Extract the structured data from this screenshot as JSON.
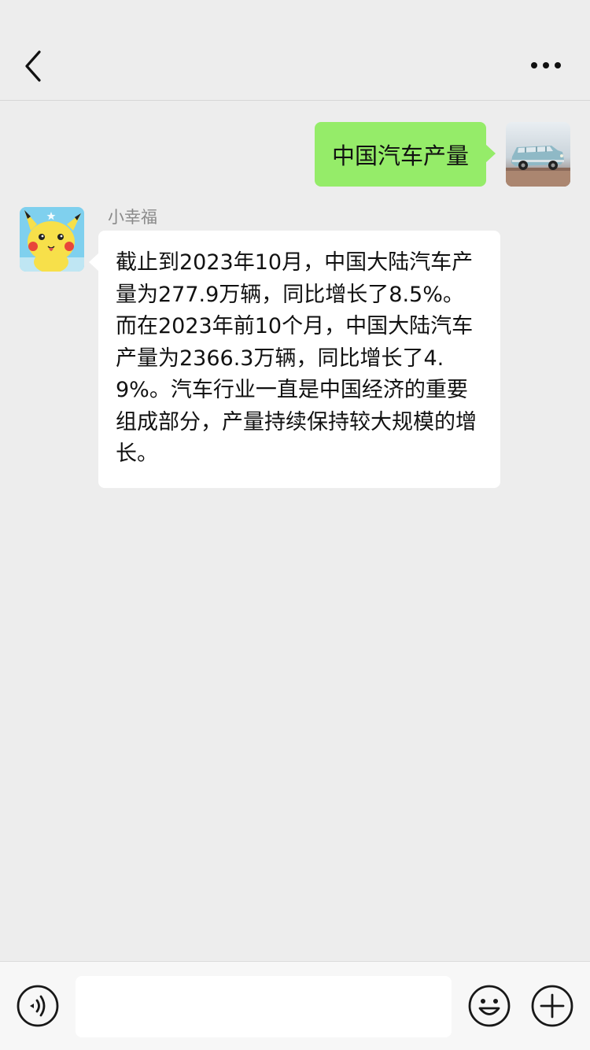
{
  "messages": {
    "outgoing": {
      "text": "中国汽车产量",
      "avatar_icon": "toy-car-avatar"
    },
    "incoming": {
      "sender": "小幸福",
      "avatar_icon": "pikachu-avatar",
      "text": "截止到2023年10月，中国大陆汽车产量为277.9万辆，同比增长了8.5%。而在2023年前10个月，中国大陆汽车产量为2366.3万辆，同比增长了4.9%。汽车行业一直是中国经济的重要组成部分，产量持续保持较大规模的增长。"
    }
  },
  "nav": {
    "back_icon": "chevron-left-icon",
    "more_icon": "more-dots-icon"
  },
  "input_bar": {
    "voice_icon": "voice-icon",
    "text_value": "",
    "emoji_icon": "emoji-icon",
    "plus_icon": "plus-icon"
  },
  "colors": {
    "background": "#ededed",
    "outgoing_bubble": "#95ec69",
    "incoming_bubble": "#ffffff",
    "sender_name": "#8a8a8a"
  }
}
